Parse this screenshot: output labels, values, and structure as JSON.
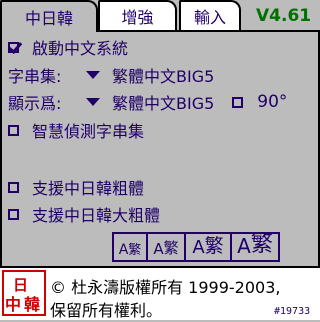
{
  "tabs": [
    {
      "label": "中日韓",
      "active": true
    },
    {
      "label": "增強",
      "active": false
    },
    {
      "label": "輸入",
      "active": false
    }
  ],
  "version": "V4.61",
  "options": {
    "enable_chinese": {
      "label": "啟動中文系統",
      "checked": true
    },
    "charset_label": "字串集:",
    "charset_value": "繁體中文BIG5",
    "display_label": "顯示爲:",
    "display_value": "繁體中文BIG5",
    "rotate": {
      "label": "90°",
      "checked": false
    },
    "smart_detect": {
      "label": "智慧偵測字串集",
      "checked": false
    },
    "support_bold": {
      "label": "支援中日韓粗體",
      "checked": false
    },
    "support_big_bold": {
      "label": "支援中日韓大粗體",
      "checked": false
    }
  },
  "font_sizes": [
    {
      "label_a": "A",
      "label_char": "繁"
    },
    {
      "label_a": "A",
      "label_char": "繁"
    },
    {
      "label_a": "A",
      "label_char": "繁"
    },
    {
      "label_a": "A",
      "label_char": "繁"
    }
  ],
  "footer": {
    "logo_text": "中日韓",
    "copyright_line1": "© 杜永濤版權所有 1999-2003,",
    "copyright_line2": "保留所有權利。",
    "build": "#19733"
  },
  "colors": {
    "text": "#200068",
    "version": "#007000",
    "background": "#bcbcbc",
    "logo": "#d00000"
  }
}
